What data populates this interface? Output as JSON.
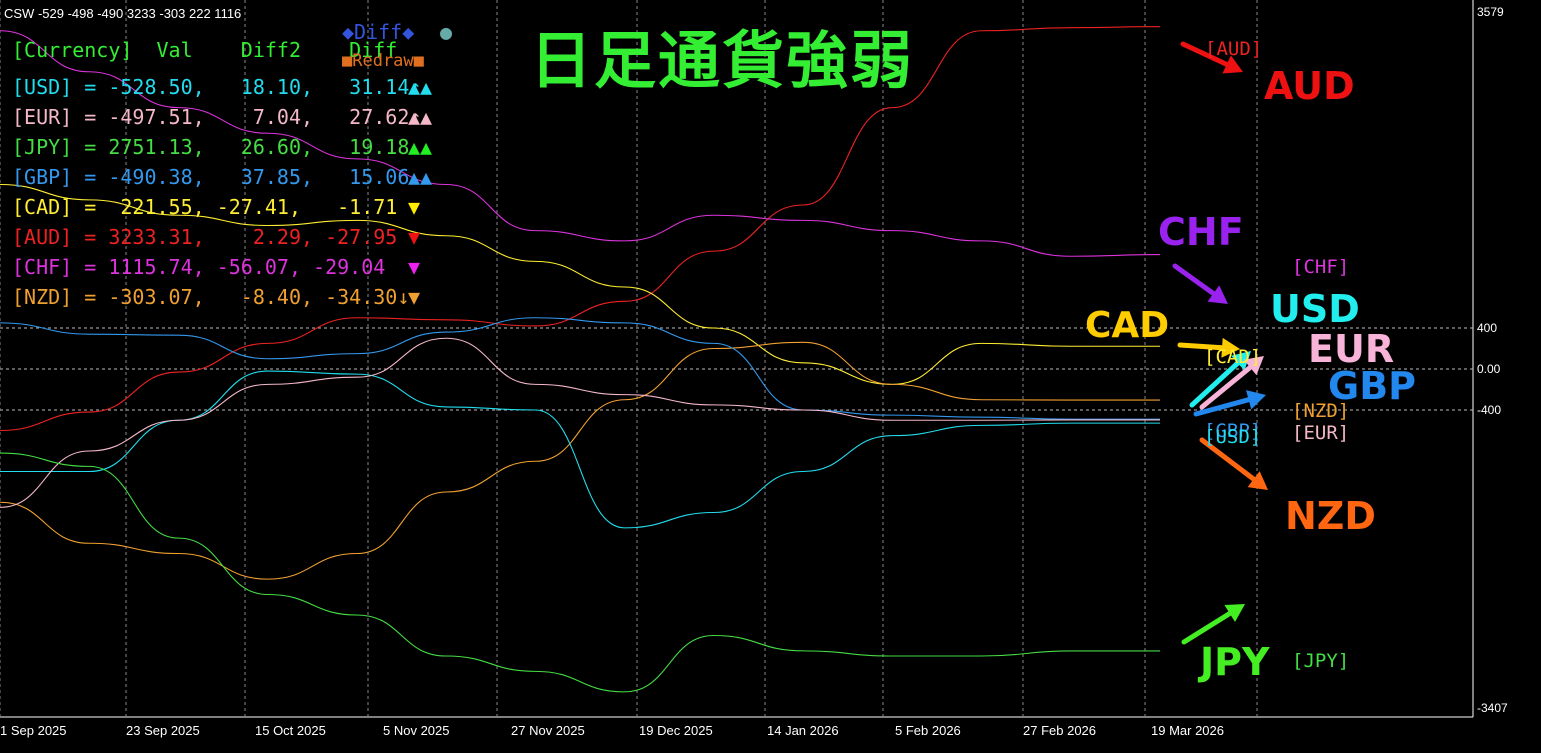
{
  "header": {
    "text": "CSW -529 -498 -490 3233 -303 222 1116"
  },
  "title": {
    "text": "日足通貨強弱",
    "color": "#33ee33"
  },
  "table": {
    "header_label": "[Currency]  Val    Diff2    Diff",
    "header_color": "#33ee33",
    "legend": {
      "diff_label": "◆Diff◆",
      "diff_color": "#3355dd",
      "circle_label": "●",
      "circle_color": "#6aa",
      "redraw_label": "■Redraw■",
      "redraw_color": "#e07020"
    },
    "rows": [
      {
        "text": "[USD] = -528.50,   18.10,   31.14↑",
        "marks": "▲▲",
        "color": "#22ddee",
        "mark_color": "#22ddee"
      },
      {
        "text": "[EUR] = -497.51,    7.04,   27.62↑",
        "marks": "▲▲",
        "color": "#f4b8c8",
        "mark_color": "#f4b8c8"
      },
      {
        "text": "[JPY] = 2751.13,   26.60,   19.18 ",
        "marks": "▲▲",
        "color": "#44dd44",
        "mark_color": "#22ee22"
      },
      {
        "text": "[GBP] = -490.38,   37.85,   15.06 ",
        "marks": "▲▲",
        "color": "#3399ee",
        "mark_color": "#3399ee"
      },
      {
        "text": "[CAD] =  221.55, -27.41,   -1.71 ",
        "marks": "▼",
        "color": "#ffee33",
        "mark_color": "#ffee00"
      },
      {
        "text": "[AUD] = 3233.31,    2.29, -27.95 ",
        "marks": "▼",
        "color": "#ee2222",
        "mark_color": "#ee1111"
      },
      {
        "text": "[CHF] = 1115.74, -56.07, -29.04 ",
        "marks": "▼",
        "color": "#dd33dd",
        "mark_color": "#ee22ee"
      },
      {
        "text": "[NZD] = -303.07,   -8.40, -34.30↓",
        "marks": "▼",
        "color": "#f0a030",
        "mark_color": "#f0a030"
      }
    ]
  },
  "annotations": [
    {
      "text": "AUD",
      "color": "#ee1111"
    },
    {
      "text": "CHF",
      "color": "#9922ee"
    },
    {
      "text": "USD",
      "color": "#22eeee"
    },
    {
      "text": "CAD",
      "color": "#ffcc00"
    },
    {
      "text": "EUR",
      "color": "#f8b4d8"
    },
    {
      "text": "GBP",
      "color": "#2288ee"
    },
    {
      "text": "NZD",
      "color": "#ff6611"
    },
    {
      "text": "JPY",
      "color": "#44ee22"
    }
  ],
  "line_labels": [
    {
      "text": "[AUD]",
      "color": "#ee2222"
    },
    {
      "text": "[CHF]",
      "color": "#dd33dd"
    },
    {
      "text": "[CAD]",
      "color": "#ffee33"
    },
    {
      "text": "[NZD]",
      "color": "#f0a030"
    },
    {
      "text": "[GBP]",
      "color": "#3399ee"
    },
    {
      "text": "[USD]",
      "color": "#22ddee"
    },
    {
      "text": "[EUR]",
      "color": "#f4b8c8"
    },
    {
      "text": "[JPY]",
      "color": "#44dd44"
    }
  ],
  "chart_data": {
    "type": "line",
    "title": "日足通貨強弱",
    "ylim": [
      -3407,
      3579
    ],
    "y_ticks": [
      {
        "label": "3579",
        "value": 3579
      },
      {
        "label": "400",
        "value": 400
      },
      {
        "label": "0.00",
        "value": 0
      },
      {
        "label": "-400",
        "value": -400
      },
      {
        "label": "-3407",
        "value": -3407
      }
    ],
    "x_ticks": [
      "1 Sep 2025",
      "23 Sep 2025",
      "15 Oct 2025",
      "5 Nov 2025",
      "27 Nov 2025",
      "19 Dec 2025",
      "14 Jan 2026",
      "5 Feb 2026",
      "27 Feb 2026",
      "19 Mar 2026"
    ],
    "grid_h": [
      400,
      0,
      -400
    ],
    "series": [
      {
        "name": "AUD",
        "color": "#ee2222",
        "values": [
          -600,
          -420,
          -30,
          250,
          500,
          480,
          420,
          660,
          1150,
          1600,
          2550,
          3300,
          3330,
          3340
        ]
      },
      {
        "name": "CHF",
        "color": "#dd33dd",
        "values": [
          3300,
          2900,
          2550,
          2300,
          2050,
          1800,
          1350,
          1250,
          1500,
          1450,
          1350,
          1250,
          1100,
          1116
        ]
      },
      {
        "name": "CAD",
        "color": "#ffee33",
        "values": [
          1800,
          1650,
          1500,
          1400,
          1450,
          1300,
          1050,
          800,
          400,
          60,
          -150,
          250,
          222,
          222
        ]
      },
      {
        "name": "NZD",
        "color": "#f0a030",
        "values": [
          -1300,
          -1700,
          -1800,
          -2050,
          -1800,
          -1200,
          -900,
          -300,
          200,
          260,
          -150,
          -300,
          -303,
          -303
        ]
      },
      {
        "name": "GBP",
        "color": "#3399ee",
        "values": [
          450,
          340,
          330,
          100,
          150,
          360,
          500,
          450,
          250,
          -400,
          -450,
          -470,
          -490,
          -490
        ]
      },
      {
        "name": "USD",
        "color": "#22ddee",
        "values": [
          -1000,
          -1000,
          -500,
          -20,
          -50,
          -370,
          -400,
          -1550,
          -1400,
          -1000,
          -650,
          -550,
          -528,
          -528
        ]
      },
      {
        "name": "EUR",
        "color": "#f4b8c8",
        "values": [
          -1350,
          -800,
          -500,
          -150,
          -80,
          300,
          -150,
          -250,
          -350,
          -400,
          -500,
          -500,
          -497,
          -497
        ]
      },
      {
        "name": "JPY",
        "color": "#44dd44",
        "values": [
          -820,
          -950,
          -1650,
          -2200,
          -2400,
          -2800,
          -2950,
          -3150,
          -2600,
          -2750,
          -2800,
          -2800,
          -2751,
          -2751
        ]
      }
    ]
  }
}
